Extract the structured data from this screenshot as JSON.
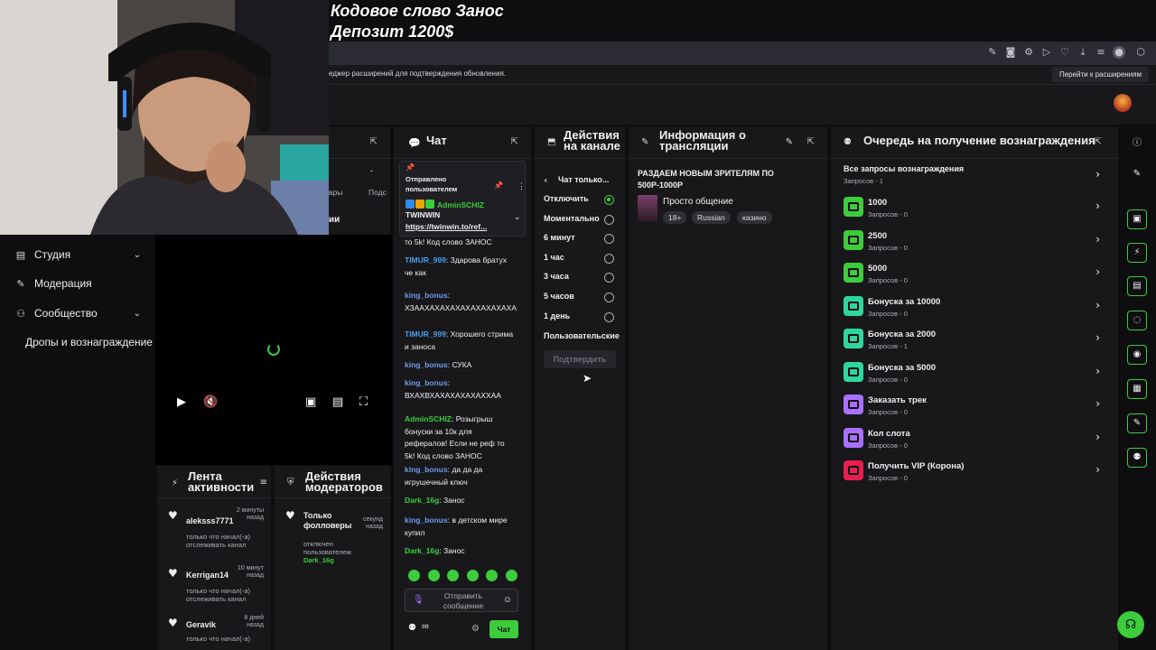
{
  "overlay": {
    "line1": "Кодовое слово Занос",
    "line2": "Депозит 1200$"
  },
  "extension_bar": {
    "message": "еджер расширений для подтверждения обновления.",
    "button": "Перейти к расширениям"
  },
  "left_nav": {
    "items": [
      {
        "label": "Студия",
        "icon": "film-icon",
        "expandable": true
      },
      {
        "label": "Модерация",
        "icon": "wrench-icon",
        "expandable": false
      },
      {
        "label": "Сообщество",
        "icon": "community-icon",
        "expandable": true
      },
      {
        "label": "Дропы и вознаграждение",
        "icon": "",
        "expandable": false
      }
    ]
  },
  "stub_panel": {
    "frag1": "вры",
    "frag2": "Подс",
    "frag3": "ии",
    "dash": "-"
  },
  "activity_feed": {
    "title": "Лента активности",
    "items": [
      {
        "name": "aleksss7771",
        "time": "2 минуты назад",
        "sub": "только что начал(-а) отслеживать канал"
      },
      {
        "name": "Kerrigan14",
        "time": "10 минут назад",
        "sub": "только что начал(-а) отслеживать канал"
      },
      {
        "name": "Geravik",
        "time": "8 дней назад",
        "sub": "только что начал(-а)"
      }
    ]
  },
  "mod_actions": {
    "title": "Действия модераторов",
    "item": {
      "name": "Только фолловеры",
      "time": "секунд назад",
      "sub": "отключен пользователем",
      "user": "Dark_16g"
    }
  },
  "chat": {
    "title": "Чат",
    "pinned": {
      "label": "Отправлено пользователем",
      "user": "AdminSCHIZ",
      "text": "TWINWIN",
      "link": "https://twinwin.to/ref..."
    },
    "messages": [
      {
        "user": "",
        "text": "то 5k! Код слово ЗАНОС",
        "color": "#efeff1"
      },
      {
        "user": "TIMUR_999",
        "text": "Здарова братух че как",
        "color": "#4b9ce8"
      },
      {
        "user": "king_bonus",
        "text": "ХЗААХАХАХАХАХАХАХАХАХА",
        "color": "#6f9ae8"
      },
      {
        "user": "TIMUR_999",
        "text": "Хорошего стрима и заноса",
        "color": "#4b9ce8"
      },
      {
        "user": "king_bonus",
        "text": "СУКА",
        "color": "#6f9ae8"
      },
      {
        "user": "king_bonus",
        "text": "ВХАХВХАХАХАХАХАХХАА",
        "color": "#6f9ae8"
      },
      {
        "user": "AdminSCHIZ",
        "text": "Розыгрыш бонуски за 10к для рефералов! Если не реф то 5k! Код слово ЗАНОС",
        "color": "#3ccc3c"
      },
      {
        "user": "king_bonus",
        "text": "да да да игрушечный ключ",
        "color": "#6f9ae8"
      },
      {
        "user": "Dark_16g",
        "text": "Занос",
        "color": "#3ccc3c"
      },
      {
        "user": "king_bonus",
        "text": "в детском мире купил",
        "color": "#6f9ae8"
      },
      {
        "user": "Dark_16g",
        "text": "Занос",
        "color": "#3ccc3c"
      }
    ],
    "input_placeholder": "Отправить сообщение",
    "send_label": "Чат",
    "points": "∞"
  },
  "channel_actions": {
    "title": "Действия на канале",
    "back_label": "Чат только...",
    "options": [
      {
        "label": "Отключить",
        "selected": true
      },
      {
        "label": "Моментально",
        "selected": false
      },
      {
        "label": "6 минут",
        "selected": false
      },
      {
        "label": "1 час",
        "selected": false
      },
      {
        "label": "3 часа",
        "selected": false
      },
      {
        "label": "5 часов",
        "selected": false
      },
      {
        "label": "1 день",
        "selected": false
      }
    ],
    "custom_label": "Пользовательские",
    "confirm_label": "Подтвердить"
  },
  "stream_info": {
    "title": "Информация о трансляции",
    "stream_title": "РАЗДАЕМ НОВЫМ ЗРИТЕЛЯМ ПО 500Р-1000Р",
    "category": "Просто общение",
    "tags": [
      "18+",
      "Russian",
      "казино"
    ]
  },
  "rewards": {
    "title": "Очередь на получение вознаграждения",
    "all_label": "Все запросы вознаграждения",
    "all_count": "Запросов - 1",
    "items": [
      {
        "title": "1000",
        "sub": "Запросов - 0",
        "color": "#3ccc3c"
      },
      {
        "title": "2500",
        "sub": "Запросов - 0",
        "color": "#3ccc3c"
      },
      {
        "title": "5000",
        "sub": "Запросов - 0",
        "color": "#3ccc3c"
      },
      {
        "title": "Бонуска за 10000",
        "sub": "Запросов - 0",
        "color": "#2ed6a0"
      },
      {
        "title": "Бонуска за 2000",
        "sub": "Запросов - 1",
        "color": "#2ed6a0"
      },
      {
        "title": "Бонуска за 5000",
        "sub": "Запросов - 0",
        "color": "#2ed6a0"
      },
      {
        "title": "Заказать трек",
        "sub": "Запросов - 0",
        "color": "#a970ff"
      },
      {
        "title": "Кол слота",
        "sub": "Запросов - 0",
        "color": "#a970ff"
      },
      {
        "title": "Получить VIP (Корона)",
        "sub": "Запросов - 0",
        "color": "#e91e4f"
      }
    ]
  },
  "colors": {
    "accent": "#3ccc3c",
    "bg": "#0e0e10",
    "panel": "#18181b"
  }
}
